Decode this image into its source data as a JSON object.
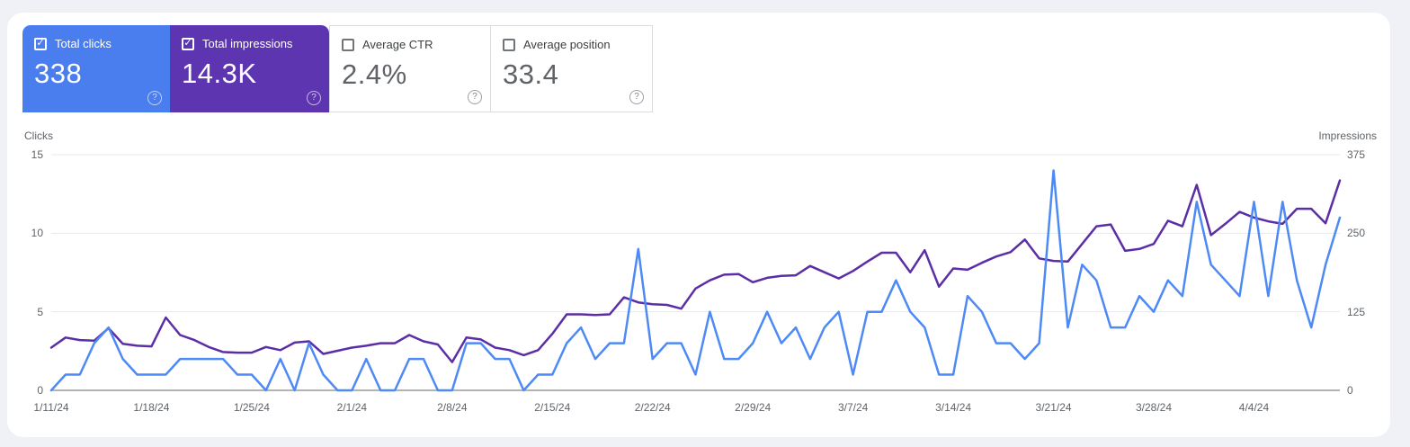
{
  "page": {
    "background": "#eff1f7",
    "panel_background": "#ffffff"
  },
  "cards": [
    {
      "id": "total-clicks",
      "label": "Total clicks",
      "value": "338",
      "checked": true,
      "style": "blue",
      "bg": "#4a7ded"
    },
    {
      "id": "total-impressions",
      "label": "Total impressions",
      "value": "14.3K",
      "checked": true,
      "style": "purple",
      "bg": "#5e35b1"
    },
    {
      "id": "average-ctr",
      "label": "Average CTR",
      "value": "2.4%",
      "checked": false,
      "style": "plain"
    },
    {
      "id": "average-position",
      "label": "Average position",
      "value": "33.4",
      "checked": false,
      "style": "plain"
    }
  ],
  "chart_data": {
    "type": "line",
    "left_axis": {
      "title": "Clicks",
      "ticks": [
        15,
        10,
        5,
        0
      ],
      "max": 15
    },
    "right_axis": {
      "title": "Impressions",
      "ticks": [
        375,
        250,
        125,
        0
      ],
      "max": 375
    },
    "x_ticks": [
      {
        "index": 0,
        "label": "1/11/24"
      },
      {
        "index": 7,
        "label": "1/18/24"
      },
      {
        "index": 14,
        "label": "1/25/24"
      },
      {
        "index": 21,
        "label": "2/1/24"
      },
      {
        "index": 28,
        "label": "2/8/24"
      },
      {
        "index": 35,
        "label": "2/15/24"
      },
      {
        "index": 42,
        "label": "2/22/24"
      },
      {
        "index": 49,
        "label": "2/29/24"
      },
      {
        "index": 56,
        "label": "3/7/24"
      },
      {
        "index": 63,
        "label": "3/14/24"
      },
      {
        "index": 70,
        "label": "3/21/24"
      },
      {
        "index": 77,
        "label": "3/28/24"
      },
      {
        "index": 84,
        "label": "4/4/24"
      }
    ],
    "series": [
      {
        "name": "Total clicks",
        "axis": "left",
        "color": "#4e8af5",
        "values": [
          0,
          1,
          1,
          3,
          4,
          2,
          1,
          1,
          1,
          2,
          2,
          2,
          2,
          1,
          1,
          0,
          2,
          0,
          3,
          1,
          0,
          0,
          2,
          0,
          0,
          2,
          2,
          0,
          0,
          3,
          3,
          2,
          2,
          0,
          1,
          1,
          3,
          4,
          2,
          3,
          3,
          9,
          2,
          3,
          3,
          1,
          5,
          2,
          2,
          3,
          5,
          3,
          4,
          2,
          4,
          5,
          1,
          5,
          5,
          7,
          5,
          4,
          1,
          1,
          6,
          5,
          3,
          3,
          2,
          3,
          14,
          4,
          8,
          7,
          4,
          4,
          6,
          5,
          7,
          6,
          12,
          8,
          7,
          6,
          12,
          6,
          12,
          7,
          4,
          8,
          11
        ]
      },
      {
        "name": "Total impressions",
        "axis": "right",
        "color": "#5c2ea6",
        "values": [
          68,
          84,
          80,
          79,
          99,
          74,
          71,
          70,
          116,
          88,
          80,
          69,
          61,
          60,
          60,
          69,
          64,
          76,
          78,
          58,
          63,
          68,
          71,
          75,
          75,
          88,
          78,
          73,
          45,
          84,
          81,
          68,
          64,
          56,
          64,
          90,
          121,
          121,
          120,
          121,
          148,
          140,
          137,
          136,
          130,
          162,
          175,
          184,
          185,
          172,
          179,
          182,
          183,
          198,
          188,
          178,
          190,
          205,
          219,
          219,
          188,
          223,
          165,
          194,
          192,
          203,
          213,
          220,
          240,
          210,
          206,
          205,
          233,
          261,
          264,
          222,
          225,
          233,
          270,
          261,
          327,
          247,
          265,
          284,
          275,
          269,
          265,
          289,
          289,
          266,
          334
        ]
      }
    ],
    "grid_color": "#e8eaed",
    "axis_line_color": "#80868b"
  }
}
